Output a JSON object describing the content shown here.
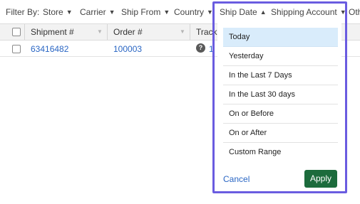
{
  "filter_bar": {
    "label": "Filter By:",
    "items": [
      {
        "label": "Store",
        "caret": "▼"
      },
      {
        "label": "Carrier",
        "caret": "▼"
      },
      {
        "label": "Ship From",
        "caret": "▼"
      },
      {
        "label": "Country",
        "caret": "▼"
      },
      {
        "label": "Ship Date",
        "caret": "▲"
      },
      {
        "label": "Shipping Account",
        "caret": "▼"
      },
      {
        "label": "Oth"
      }
    ]
  },
  "table": {
    "headers": [
      "Shipment #",
      "Order #",
      "Track"
    ],
    "rows": [
      {
        "shipment": "63416482",
        "order": "100003",
        "tracking": "1"
      }
    ]
  },
  "ship_date_dropdown": {
    "options": [
      "Today",
      "Yesterday",
      "In the Last 7 Days",
      "In the Last 30 days",
      "On or Before",
      "On or After",
      "Custom Range"
    ],
    "selected": "Today",
    "cancel_label": "Cancel",
    "apply_label": "Apply"
  },
  "colors": {
    "accent_outline": "#6a5ce0",
    "apply_button": "#1c6b3c",
    "link": "#2a66c4",
    "selected_option": "#d9ecfb"
  },
  "icons": {
    "help": "help-circle-icon"
  }
}
